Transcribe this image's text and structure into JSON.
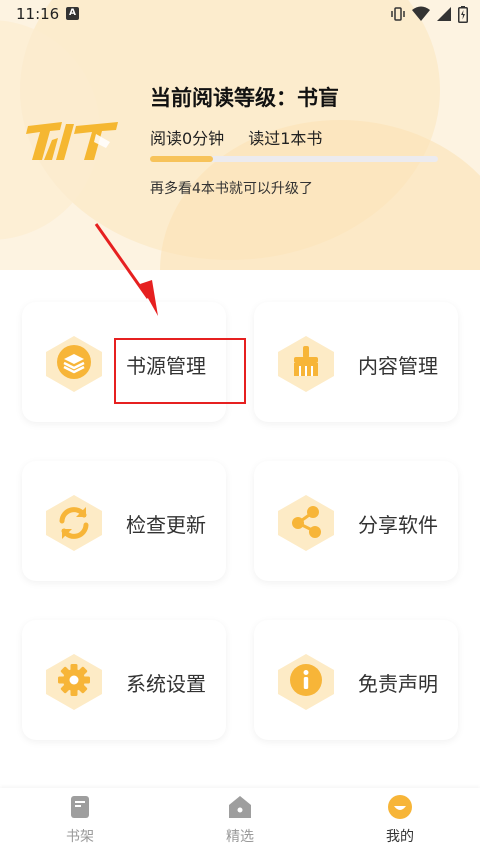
{
  "status": {
    "time": "11:16",
    "notif_glyph": "A"
  },
  "header": {
    "level_title": "当前阅读等级：书盲",
    "read_time": "阅读0分钟",
    "books_read": "读过1本书",
    "progress": 0.22,
    "hint": "再多看4本书就可以升级了"
  },
  "menu": [
    {
      "label": "书源管理",
      "icon": "layers-icon"
    },
    {
      "label": "内容管理",
      "icon": "broom-icon"
    },
    {
      "label": "检查更新",
      "icon": "refresh-icon"
    },
    {
      "label": "分享软件",
      "icon": "share-icon"
    },
    {
      "label": "系统设置",
      "icon": "gear-icon"
    },
    {
      "label": "免责声明",
      "icon": "info-icon"
    }
  ],
  "nav": [
    {
      "label": "书架",
      "icon": "bookshelf-icon",
      "active": false
    },
    {
      "label": "精选",
      "icon": "home-icon",
      "active": false
    },
    {
      "label": "我的",
      "icon": "smile-icon",
      "active": true
    }
  ],
  "colors": {
    "accent": "#f7b538",
    "annotation": "#e62020"
  }
}
